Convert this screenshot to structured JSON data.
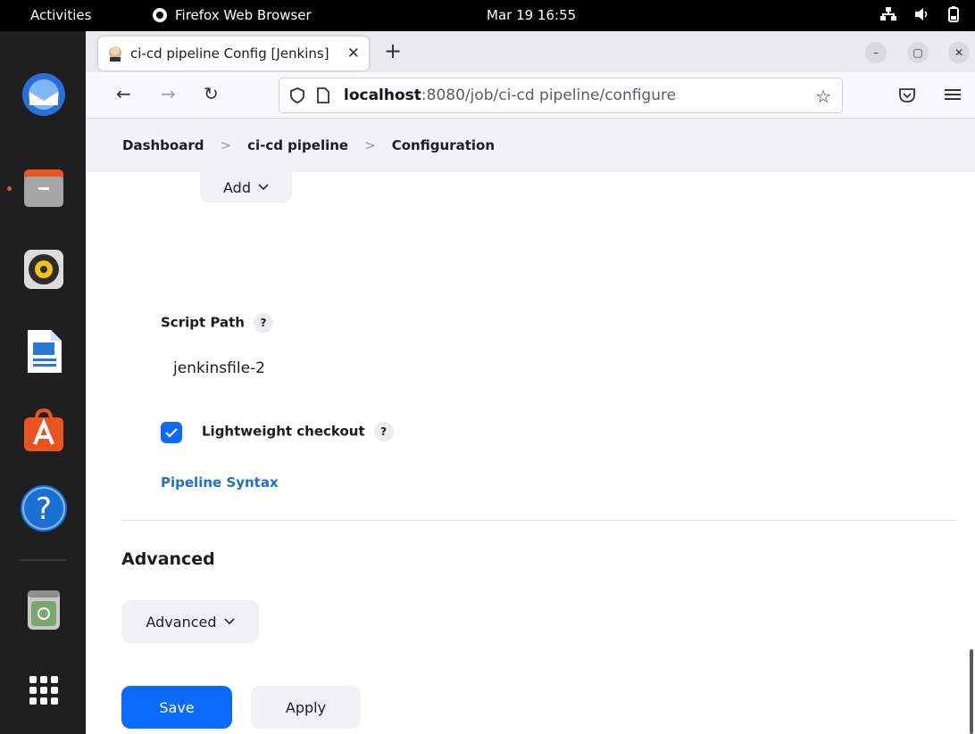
{
  "topbar": {
    "activities": "Activities",
    "app_name": "Firefox Web Browser",
    "datetime": "Mar 19  16:55",
    "icons": [
      "network-icon",
      "volume-icon",
      "battery-icon"
    ]
  },
  "dock": {
    "apps": [
      "thunderbird-icon",
      "files-icon",
      "rhythmbox-icon",
      "libreoffice-writer-icon",
      "software-center-icon",
      "help-icon",
      "trash-icon",
      "app-grid-icon"
    ],
    "help_glyph": "?"
  },
  "browser": {
    "tab_title": "ci-cd pipeline Config [Jenkins]",
    "new_tab": "+",
    "url_host": "localhost",
    "url_rest": ":8080/job/ci-cd pipeline/configure"
  },
  "breadcrumb": {
    "items": [
      "Dashboard",
      "ci-cd pipeline",
      "Configuration"
    ],
    "separator": ">"
  },
  "form": {
    "add_button": "Add",
    "script_path_label": "Script Path",
    "help_glyph": "?",
    "script_path_value": "jenkinsfile-2",
    "lightweight_checkout_label": "Lightweight checkout",
    "lightweight_checkout_checked": true,
    "pipeline_syntax_link": "Pipeline Syntax",
    "advanced_title": "Advanced",
    "advanced_button": "Advanced",
    "save_button": "Save",
    "apply_button": "Apply"
  },
  "colors": {
    "primary": "#0b6aff",
    "link": "#1f6fd0",
    "ubuntu_accent": "#e95420"
  }
}
